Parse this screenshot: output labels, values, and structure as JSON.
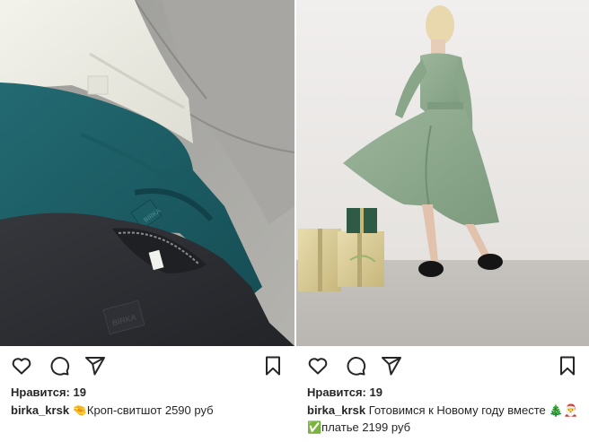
{
  "posts": [
    {
      "likes_text": "Нравится: 19",
      "username": "birka_krsk",
      "caption_lines": [
        "🤏Кроп-свитшот 2590 руб"
      ],
      "photo_label": "BIRKA",
      "icons": [
        "heart-icon",
        "comment-icon",
        "share-icon",
        "bookmark-icon"
      ]
    },
    {
      "likes_text": "Нравится: 19",
      "username": "birka_krsk",
      "caption_lines": [
        "Готовимся к Новому году вместе 🎄🎅",
        "✅платье 2199 руб"
      ],
      "icons": [
        "heart-icon",
        "comment-icon",
        "share-icon",
        "bookmark-icon"
      ]
    }
  ],
  "colors": {
    "text": "#262626",
    "background": "#ffffff",
    "dress_green": "#8fa98f",
    "sweater_teal": "#1f5f66",
    "sweater_black": "#2b2d31",
    "sweater_cream": "#eeeee6"
  }
}
